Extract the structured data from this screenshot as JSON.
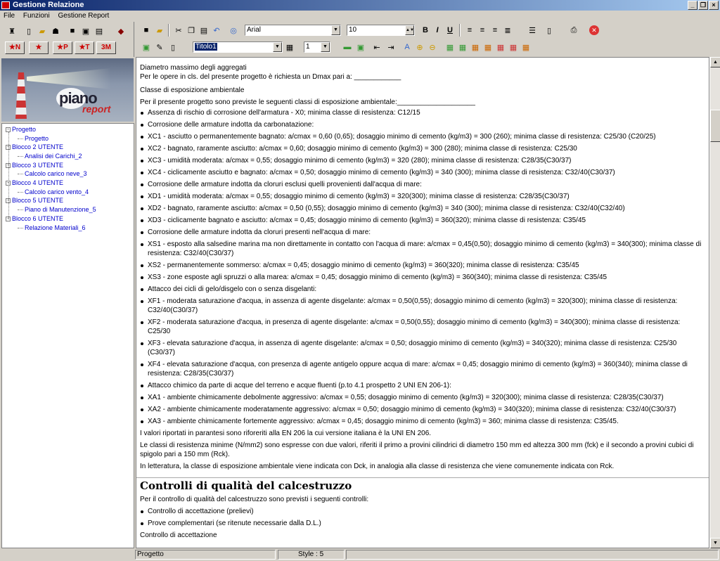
{
  "window": {
    "title": "Gestione Relazione"
  },
  "menu": [
    "File",
    "Funzioni",
    "Gestione Report"
  ],
  "left_toolbar": {
    "big_buttons": [
      "★N",
      "★",
      "★P",
      "★T",
      "3M"
    ]
  },
  "format_toolbar": {
    "font": "Arial",
    "size": "10",
    "style": "Titolo1",
    "level": "1"
  },
  "banner": {
    "logo_line1": "piano",
    "logo_line2": "report"
  },
  "tree": [
    {
      "label": "Progetto",
      "level": 0
    },
    {
      "label": "Progetto",
      "level": 1
    },
    {
      "label": "Blocco 2 UTENTE",
      "level": 0
    },
    {
      "label": "Analisi dei Carichi_2",
      "level": 1
    },
    {
      "label": "Blocco 3 UTENTE",
      "level": 0
    },
    {
      "label": "Calcolo carico neve_3",
      "level": 1
    },
    {
      "label": "Blocco 4 UTENTE",
      "level": 0
    },
    {
      "label": "Calcolo carico vento_4",
      "level": 1
    },
    {
      "label": "Blocco 5 UTENTE",
      "level": 0
    },
    {
      "label": "Piano di Manutenzione_5",
      "level": 1
    },
    {
      "label": "Blocco 6 UTENTE",
      "level": 0
    },
    {
      "label": "Relazione Materiali_6",
      "level": 1
    }
  ],
  "document": {
    "lines": [
      {
        "t": "p",
        "text": "Diametro massimo degli aggregati"
      },
      {
        "t": "p",
        "text": "Per le opere in cls. del presente progetto è richiesta un Dmax pari a: ____________",
        "gap": 0
      },
      {
        "t": "p",
        "text": "Classe di esposizione ambientale",
        "gap": 6
      },
      {
        "t": "p",
        "text": "Per il presente progetto sono previste le seguenti classi di esposizione ambientale:____________________"
      },
      {
        "t": "b",
        "text": "Assenza di rischio di corrosione dell'armatura - X0; minima classe di resistenza: C12/15",
        "gap": 2
      },
      {
        "t": "b",
        "text": "Corrosione delle armature indotta da carbonatazione:"
      },
      {
        "t": "b",
        "text": "XC1 - asciutto o permanentemente bagnato: a/cmax = 0,60 (0,65); dosaggio minimo di cemento (kg/m3) = 300 (260); minima classe di resistenza: C25/30 (C20/25)"
      },
      {
        "t": "b",
        "text": "XC2 - bagnato, raramente asciutto: a/cmax = 0,60; dosaggio minimo di cemento (kg/m3) = 300 (280); minima classe di resistenza: C25/30"
      },
      {
        "t": "b",
        "text": "XC3 - umidità moderata: a/cmax = 0,55; dosaggio minimo di cemento (kg/m3) = 320 (280); minima classe di resistenza: C28/35(C30/37)"
      },
      {
        "t": "b",
        "text": "XC4 - ciclicamente asciutto e bagnato: a/cmax = 0,50; dosaggio minimo di cemento (kg/m3) = 340 (300); minima classe di resistenza: C32/40(C30/37)"
      },
      {
        "t": "b",
        "text": "Corrosione delle armature indotta da cloruri esclusi quelli provenienti dall'acqua di mare:"
      },
      {
        "t": "b",
        "text": "XD1 - umidità moderata: a/cmax = 0,55; dosaggio minimo di cemento (kg/m3) = 320(300); minima classe di resistenza: C28/35(C30/37)"
      },
      {
        "t": "b",
        "text": "XD2 - bagnato, raramente asciutto: a/cmax = 0,50 (0,55); dosaggio minimo di cemento (kg/m3) = 340 (300); minima classe di resistenza: C32/40(C32/40)"
      },
      {
        "t": "b",
        "text": "XD3 - ciclicamente bagnato e asciutto: a/cmax = 0,45; dosaggio minimo di cemento (kg/m3) = 360(320); minima classe di resistenza: C35/45"
      },
      {
        "t": "b",
        "text": "Corrosione delle armature indotta da cloruri presenti nell'acqua di mare:"
      },
      {
        "t": "b",
        "text": "XS1 - esposto alla salsedine marina ma non direttamente in contatto con l'acqua di mare: a/cmax = 0,45(0,50); dosaggio minimo di cemento (kg/m3) = 340(300); minima classe di resistenza: C32/40(C30/37)"
      },
      {
        "t": "b",
        "text": "XS2 - permanentemente sommerso: a/cmax = 0,45; dosaggio minimo di cemento (kg/m3) = 360(320); minima classe di resistenza: C35/45"
      },
      {
        "t": "b",
        "text": "XS3 - zone esposte agli spruzzi o alla marea: a/cmax = 0,45; dosaggio minimo di cemento (kg/m3) = 360(340); minima classe di resistenza: C35/45"
      },
      {
        "t": "b",
        "text": "Attacco dei cicli di gelo/disgelo con o senza disgelanti:"
      },
      {
        "t": "b",
        "text": "XF1 - moderata saturazione d'acqua, in assenza di agente disgelante: a/cmax = 0,50(0,55); dosaggio minimo di cemento (kg/m3) = 320(300); minima classe di resistenza: C32/40(C30/37)"
      },
      {
        "t": "b",
        "text": "XF2 - moderata saturazione d'acqua, in presenza di agente disgelante: a/cmax = 0,50(0,55); dosaggio minimo di cemento (kg/m3) = 340(300); minima classe di resistenza: C25/30"
      },
      {
        "t": "b",
        "text": "XF3 - elevata saturazione d'acqua, in assenza di agente disgelante: a/cmax = 0,50; dosaggio minimo di cemento (kg/m3) = 340(320); minima classe di resistenza: C25/30 (C30/37)"
      },
      {
        "t": "b",
        "text": "XF4 - elevata saturazione d'acqua, con presenza di agente antigelo oppure acqua di mare: a/cmax = 0,45; dosaggio minimo di cemento (kg/m3) = 360(340); minima classe di resistenza: C28/35(C30/37)"
      },
      {
        "t": "b",
        "text": "Attacco chimico da parte di acque del terreno e acque fluenti (p.to 4.1 prospetto 2 UNI EN 206-1):"
      },
      {
        "t": "b",
        "text": "XA1 - ambiente chimicamente debolmente aggressivo: a/cmax = 0,55; dosaggio minimo di cemento (kg/m3) = 320(300); minima classe di resistenza: C28/35(C30/37)"
      },
      {
        "t": "b",
        "text": "XA2 - ambiente chimicamente moderatamente aggressivo: a/cmax = 0,50; dosaggio minimo di cemento (kg/m3) = 340(320); minima classe di resistenza: C32/40(C30/37)"
      },
      {
        "t": "b",
        "text": "XA3 - ambiente chimicamente fortemente aggressivo: a/cmax = 0,45; dosaggio minimo di cemento (kg/m3) = 360; minima classe di resistenza: C35/45."
      },
      {
        "t": "p",
        "text": "I valori riportati in parantesi sono riforeriti alla EN 206 la cui versione italiana è la UNI EN 206."
      },
      {
        "t": "p",
        "text": "Le classi di resistenza minime (N/mm2) sono espresse con due valori, riferiti il primo a provini cilindrici di diametro 150 mm ed altezza 300 mm (fck) e il secondo a provini cubici di spigolo pari a 150 mm (Rck)."
      },
      {
        "t": "p",
        "text": "In letteratura, la classe di esposizione ambientale viene indicata con Dck, in analogia alla classe di resistenza che viene comunemente indicata con Rck."
      }
    ],
    "heading2": "Controlli di qualità del calcestruzzo",
    "after": [
      {
        "t": "p",
        "text": "Per il controllo di qualità del calcestruzzo sono previsti i seguenti controlli:"
      },
      {
        "t": "b",
        "text": "Controllo di accettazione (prelievi)"
      },
      {
        "t": "b",
        "text": "Prove complementari (se ritenute necessarie dalla D.L.)"
      },
      {
        "t": "p",
        "text": "Controllo di accettazione"
      }
    ]
  },
  "status": {
    "left": "Progetto",
    "style": "Style : 5"
  }
}
